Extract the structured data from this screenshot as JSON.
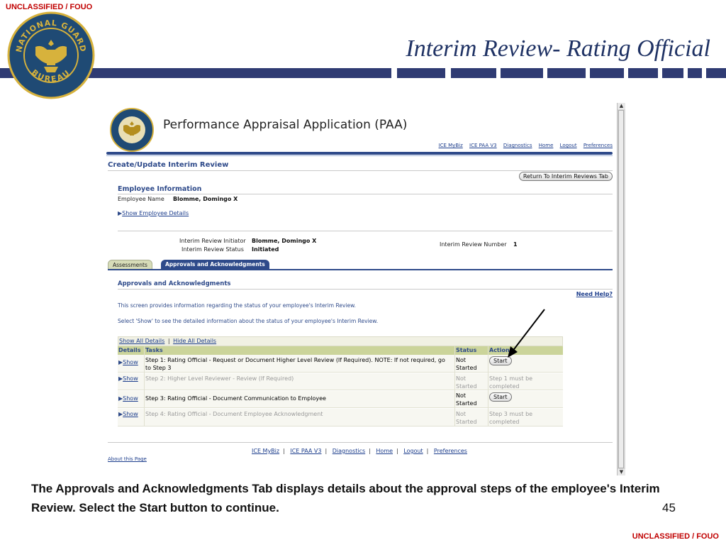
{
  "classification": {
    "top": "UNCLASSIFIED / FOUO",
    "bottom": "UNCLASSIFIED / FOUO"
  },
  "slide": {
    "title": "Interim Review- Rating Official",
    "page_number": "45"
  },
  "logo": {
    "text_top": "NATIONAL GUARD",
    "text_bottom": "BUREAU"
  },
  "colors": {
    "navy": "#2f3b73",
    "classification_red": "#c00000",
    "oaf_blue": "#2e4a8a",
    "table_header": "#cbd49a"
  },
  "app": {
    "title": "Performance Appraisal Application (PAA)",
    "global_links": [
      "ICE MyBiz",
      "ICE PAA V3",
      "Diagnostics",
      "Home",
      "Logout",
      "Preferences"
    ],
    "page_heading": "Create/Update Interim Review",
    "return_button": "Return To Interim Reviews Tab",
    "employee_info": {
      "heading": "Employee Information",
      "name_label": "Employee Name",
      "name_value": "Blomme, Domingo X",
      "show_details_link": "Show Employee Details"
    },
    "review": {
      "initiator_label": "Interim Review Initiator",
      "initiator_value": "Blomme, Domingo X",
      "status_label": "Interim Review Status",
      "status_value": "Initiated",
      "number_label": "Interim Review Number",
      "number_value": "1"
    },
    "tabs": [
      {
        "label": "Assessments",
        "active": false
      },
      {
        "label": "Approvals and Acknowledgments",
        "active": true
      }
    ],
    "section": {
      "heading": "Approvals and Acknowledgments",
      "need_help": "Need Help?",
      "info_1": "This screen provides information regarding the status of your employee's Interim Review.",
      "info_2": "Select 'Show' to see the detailed information about the status of your employee's Interim Review."
    },
    "table": {
      "show_all": "Show All Details",
      "separator": "|",
      "hide_all": "Hide All Details",
      "columns": [
        "Details",
        "Tasks",
        "Status",
        "Action"
      ],
      "rows": [
        {
          "show": "Show",
          "task_line1": "Step 1: Rating Official - Request or Document Higher Level Review (If Required). NOTE: If not required, go",
          "task_line2": "to Step 3",
          "status_line1": "Not",
          "status_line2": "Started",
          "action_button": "Start",
          "action_line1": "",
          "action_line2": "",
          "enabled": true
        },
        {
          "show": "Show",
          "task_line1": "Step 2: Higher Level Reviewer - Review (If Required)",
          "task_line2": "",
          "status_line1": "Not",
          "status_line2": "Started",
          "action_button": "",
          "action_line1": "Step 1 must be",
          "action_line2": "completed",
          "enabled": false
        },
        {
          "show": "Show",
          "task_line1": "Step 3: Rating Official - Document Communication to Employee",
          "task_line2": "",
          "status_line1": "Not",
          "status_line2": "Started",
          "action_button": "Start",
          "action_line1": "",
          "action_line2": "",
          "enabled": true
        },
        {
          "show": "Show",
          "task_line1": "Step 4: Rating Official - Document Employee Acknowledgment",
          "task_line2": "",
          "status_line1": "Not",
          "status_line2": "Started",
          "action_button": "",
          "action_line1": "Step 3 must be",
          "action_line2": "completed",
          "enabled": false
        }
      ]
    },
    "footer_links": [
      "ICE MyBiz",
      "ICE PAA V3",
      "Diagnostics",
      "Home",
      "Logout",
      "Preferences"
    ],
    "footer_separator": "|",
    "about_page": "About this Page"
  },
  "caption": "The Approvals and Acknowledgments Tab displays details about the approval steps of the employee's Interim Review. Select the Start button to continue."
}
